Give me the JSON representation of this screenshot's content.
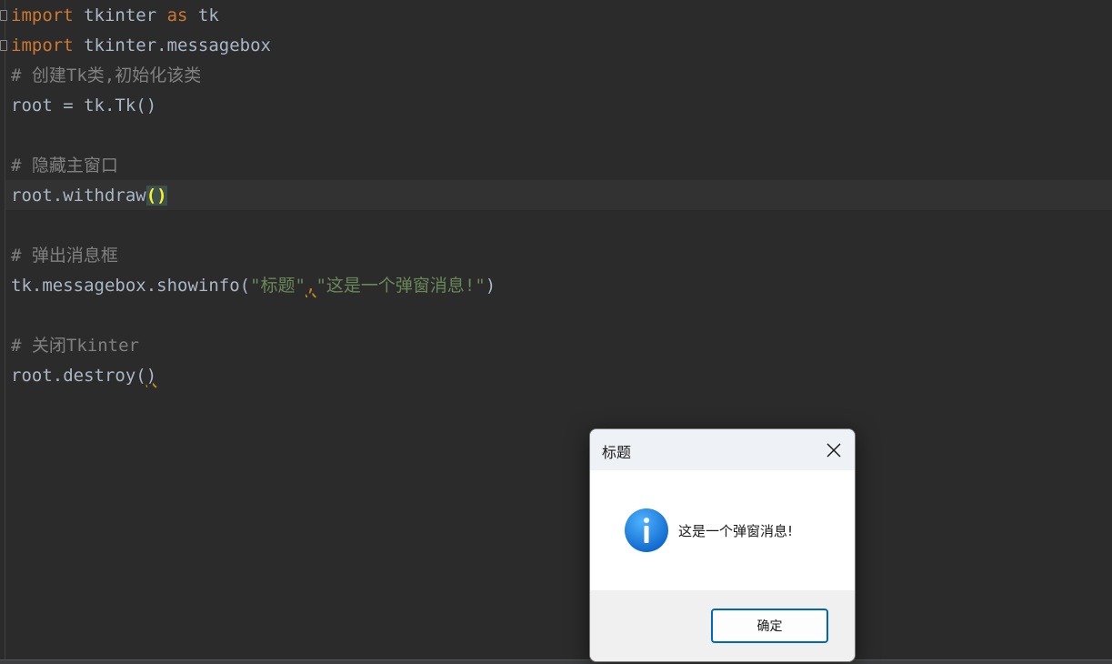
{
  "editor": {
    "lines": {
      "l1": {
        "kw1": "import",
        "mod": " tkinter ",
        "kw2": "as",
        "alias": " tk"
      },
      "l2": {
        "kw": "import",
        "mod": " tkinter.messagebox"
      },
      "l3": {
        "comment": "# 创建Tk类,初始化该类"
      },
      "l4": {
        "code": "root = tk.Tk()"
      },
      "l6": {
        "comment": "# 隐藏主窗口"
      },
      "l7": {
        "code": "root.withdraw",
        "paren": "()"
      },
      "l9": {
        "comment": "# 弹出消息框"
      },
      "l10": {
        "prefix": "tk.messagebox.showinfo(",
        "arg1": "\"标题\"",
        "comma": ",",
        "arg2": "\"这是一个弹窗消息!\"",
        "suffix": ")"
      },
      "l12": {
        "comment": "# 关闭Tkinter"
      },
      "l13": {
        "code": "root.destroy(",
        "paren_close": ")"
      }
    },
    "colors": {
      "background": "#2b2b2b",
      "keyword": "#cc7832",
      "comment": "#808080",
      "string": "#6a8759",
      "text": "#a9b7c6",
      "bracket_highlight": "#ffef28"
    }
  },
  "dialog": {
    "title": "标题",
    "message": "这是一个弹窗消息!",
    "ok_label": "确定",
    "icon": "info-icon",
    "close_icon": "close-icon",
    "accent": "#0067c0"
  }
}
